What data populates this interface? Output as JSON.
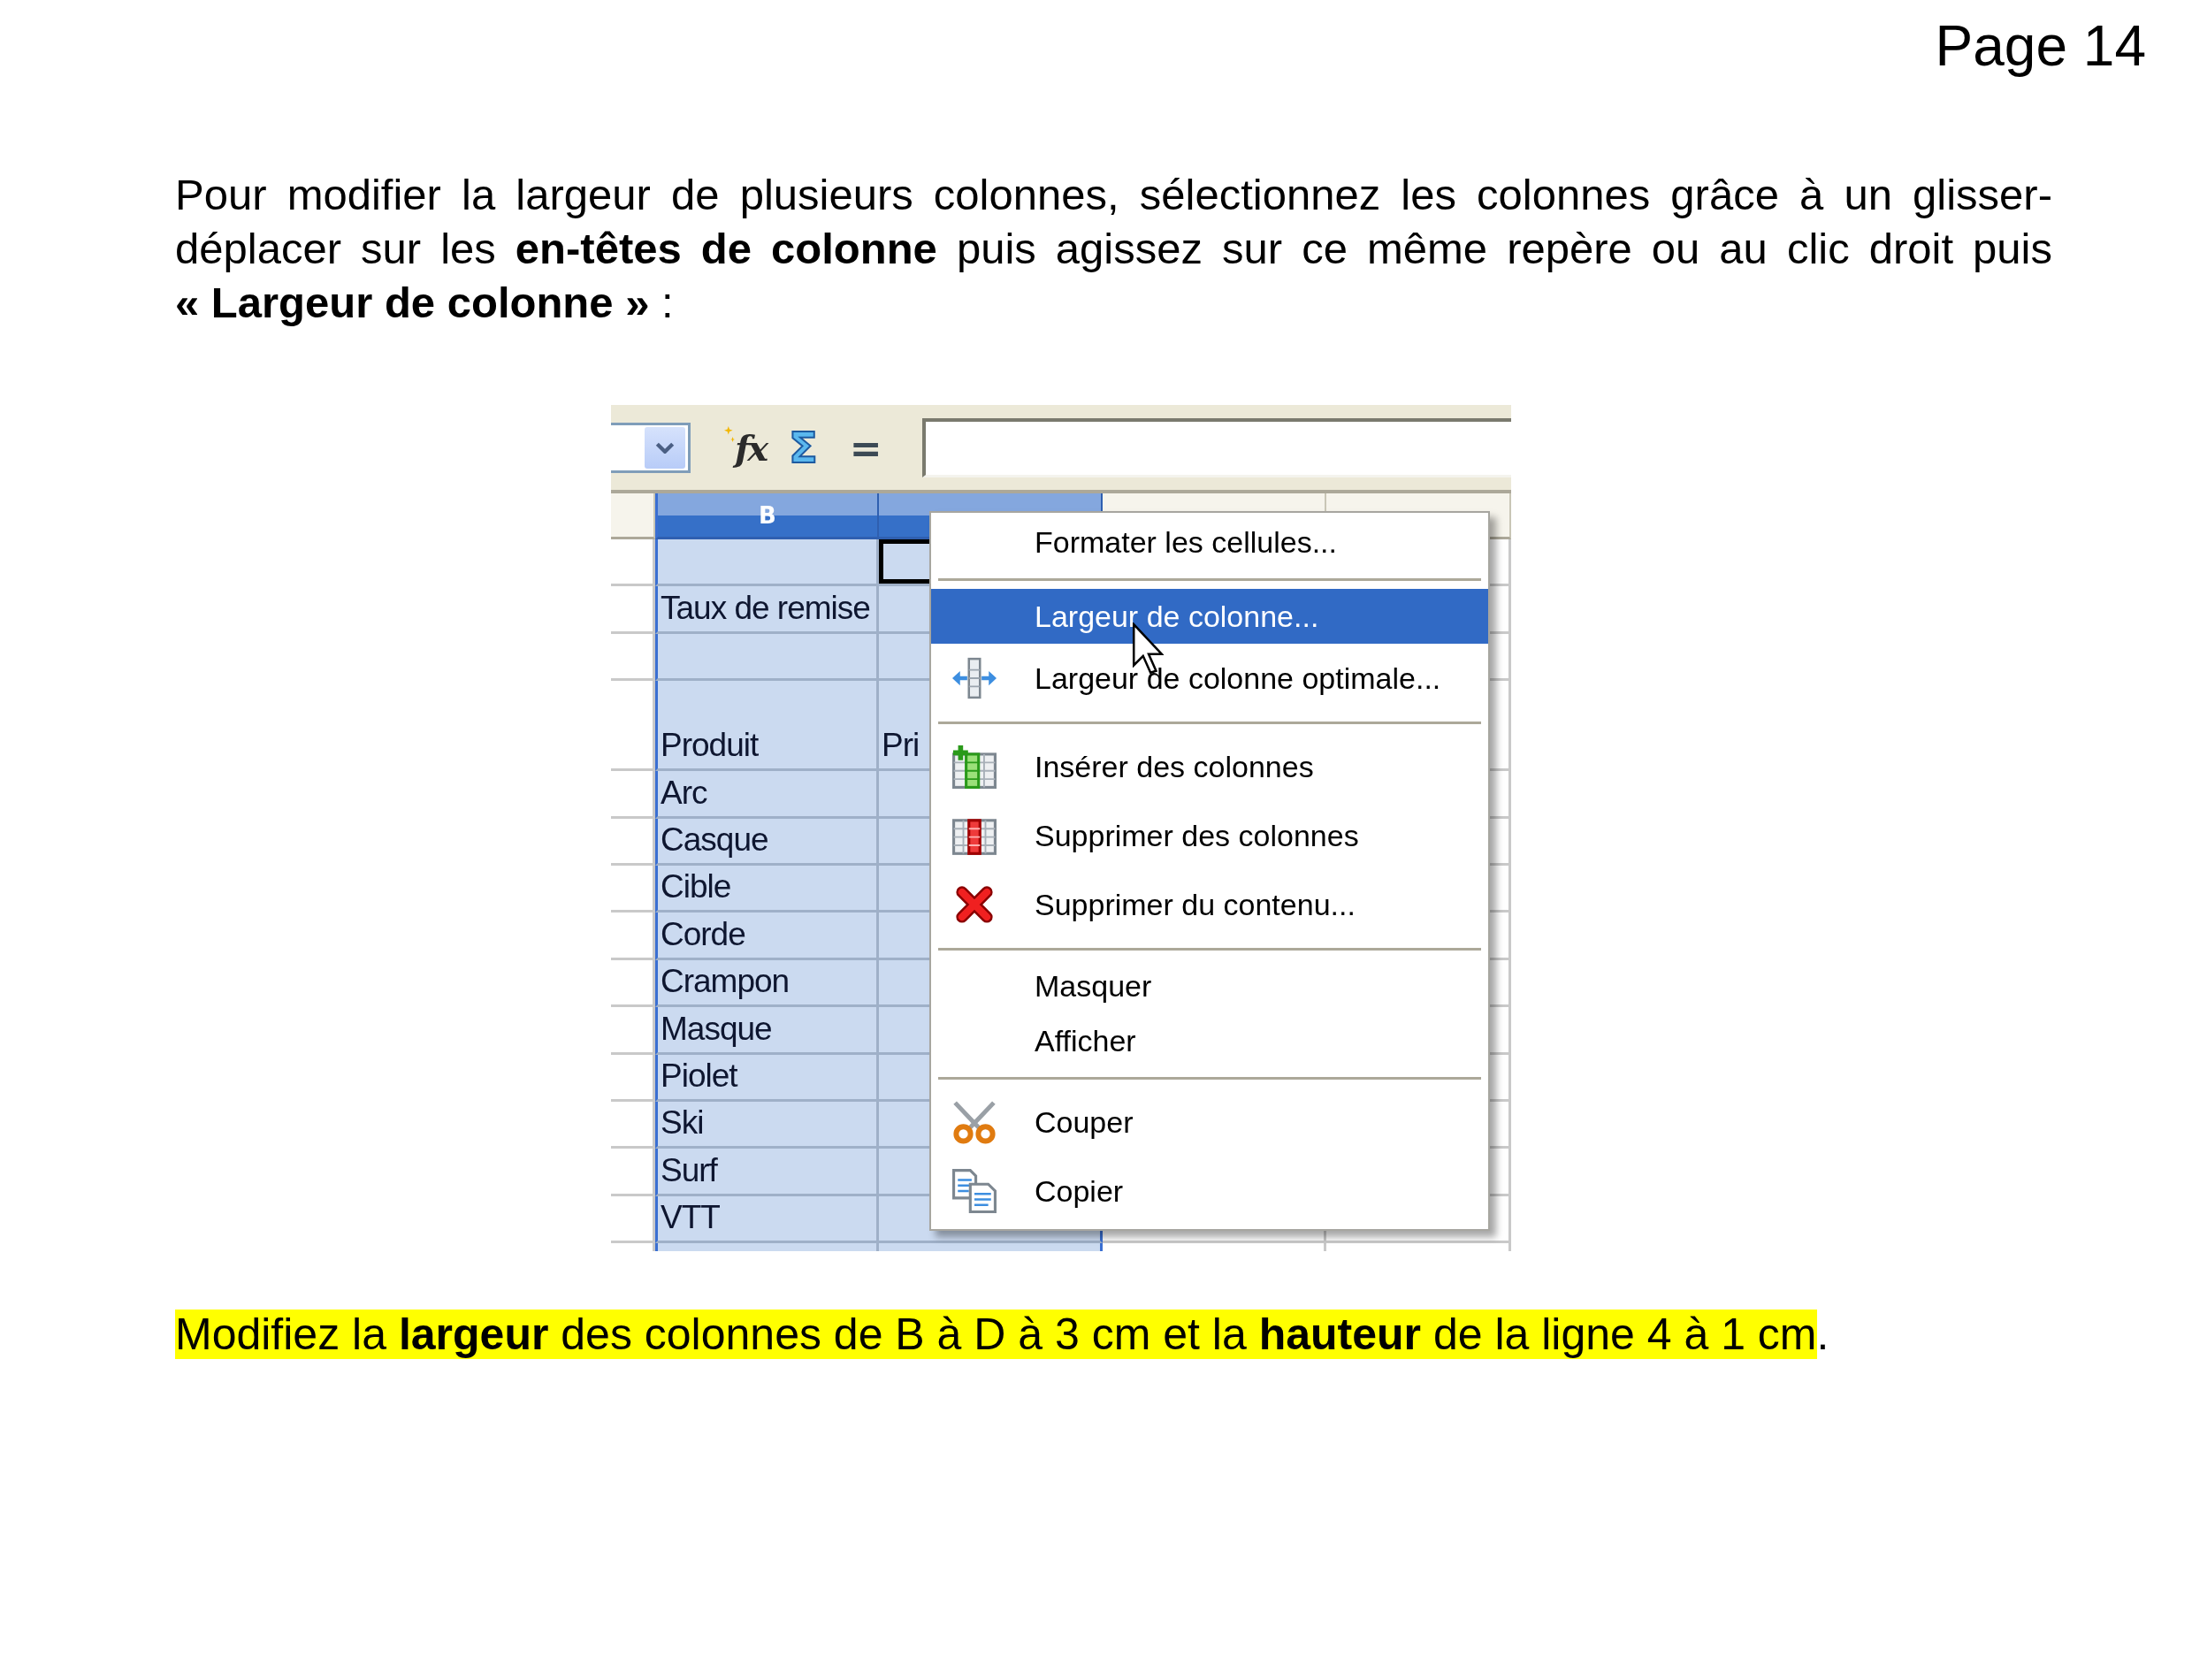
{
  "page_label": "Page 14",
  "intro": "Pour modifier la largeur de plusieurs colonnes, sélectionnez les colonnes grâce à un glisser-déplacer sur les **en-têtes de colonne** puis agissez sur ce même repère ou au clic droit puis **« Largeur de colonne »** :",
  "screenshot": {
    "toolbar": {
      "buttons": [
        {
          "kind": "function",
          "label": "fx"
        },
        {
          "kind": "sum",
          "label": "Σ"
        },
        {
          "kind": "equals",
          "label": "="
        }
      ]
    },
    "columns": [
      {
        "selected": false,
        "cursor": false
      },
      {
        "label": "B",
        "selected": true,
        "cursor": false
      },
      {
        "selected": true,
        "cursor": true
      },
      {
        "selected": false,
        "cursor": false
      },
      {
        "selected": false,
        "cursor": false
      }
    ],
    "rows": [
      {
        "cursor": true,
        "tall": false
      },
      {
        "column_b": "Taux de remise",
        "cursor": false,
        "tall": false
      },
      {
        "cursor": false,
        "tall": false
      },
      {
        "column_b": "Produit",
        "column_c": "Pri",
        "cursor": false,
        "tall": true
      },
      {
        "column_b": "Arc",
        "cursor": false,
        "tall": false
      },
      {
        "column_b": "Casque",
        "cursor": false,
        "tall": false
      },
      {
        "column_b": "Cible",
        "cursor": false,
        "tall": false
      },
      {
        "column_b": "Corde",
        "cursor": false,
        "tall": false
      },
      {
        "column_b": "Crampon",
        "cursor": false,
        "tall": false
      },
      {
        "column_b": "Masque",
        "cursor": false,
        "tall": false
      },
      {
        "column_b": "Piolet",
        "cursor": false,
        "tall": false
      },
      {
        "column_b": "Ski",
        "cursor": false,
        "tall": false
      },
      {
        "column_b": "Surf",
        "cursor": false,
        "tall": false
      },
      {
        "column_b": "VTT",
        "cursor": false,
        "tall": false
      },
      {
        "cursor": false,
        "tall": false
      }
    ],
    "context_menu": {
      "sections": [
        {
          "items": [
            {
              "label": "Formater les cellules...",
              "kind": "plain",
              "selected": false
            }
          ]
        },
        {
          "items": [
            {
              "label": "Largeur de colonne...",
              "kind": "plain",
              "selected": true
            },
            {
              "label": "Largeur de colonne optimale...",
              "kind": "resize",
              "selected": false
            }
          ]
        },
        {
          "items": [
            {
              "label": "Insérer des colonnes",
              "kind": "insert",
              "selected": false
            },
            {
              "label": "Supprimer des colonnes",
              "kind": "remove",
              "selected": false
            },
            {
              "label": "Supprimer du contenu...",
              "kind": "clear",
              "selected": false
            }
          ]
        },
        {
          "items": [
            {
              "label": "Masquer",
              "kind": "plain",
              "selected": false
            },
            {
              "label": "Afficher",
              "kind": "plain",
              "selected": false
            }
          ]
        },
        {
          "items": [
            {
              "label": "Couper",
              "kind": "cut",
              "selected": false
            },
            {
              "label": "Copier",
              "kind": "copy",
              "selected": false
            }
          ]
        }
      ]
    }
  },
  "instruction": [
    {
      "text": "Modifiez la **largeur** des colonnes de B à D à 3 cm et la **hauteur** de la ligne 4 à 1 cm",
      "highlighted": true
    },
    {
      "text": ".",
      "highlighted": false
    }
  ]
}
